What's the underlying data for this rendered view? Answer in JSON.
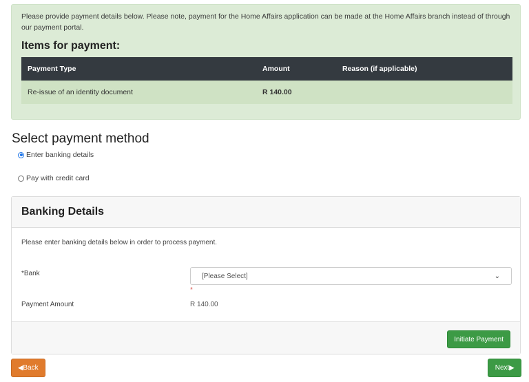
{
  "notice": {
    "text": "Please provide payment details below. Please note, payment for the Home Affairs application can be made at the Home Affairs branch instead of through our payment portal.",
    "items_title": "Items for payment:",
    "table": {
      "headers": [
        "Payment Type",
        "Amount",
        "Reason (if applicable)"
      ],
      "rows": [
        [
          "Re-issue of an identity document",
          "R 140.00",
          ""
        ]
      ]
    }
  },
  "payment_method": {
    "title": "Select payment method",
    "options": [
      {
        "label": "Enter banking details",
        "selected": true
      },
      {
        "label": "Pay with credit card",
        "selected": false
      }
    ]
  },
  "banking": {
    "title": "Banking Details",
    "description": "Please enter banking details below in order to process payment.",
    "bank_label": "*Bank",
    "bank_value": "[Please Select]",
    "required_mark": "*",
    "amount_label": "Payment Amount",
    "amount_value": "R 140.00",
    "initiate_label": "Initiate Payment"
  },
  "nav": {
    "back_label": "Back",
    "next_label": "Next"
  },
  "colors": {
    "notice_bg": "#dcebd6",
    "table_header": "#343a40",
    "success": "#3c9a45",
    "warning": "#e07b2d"
  }
}
